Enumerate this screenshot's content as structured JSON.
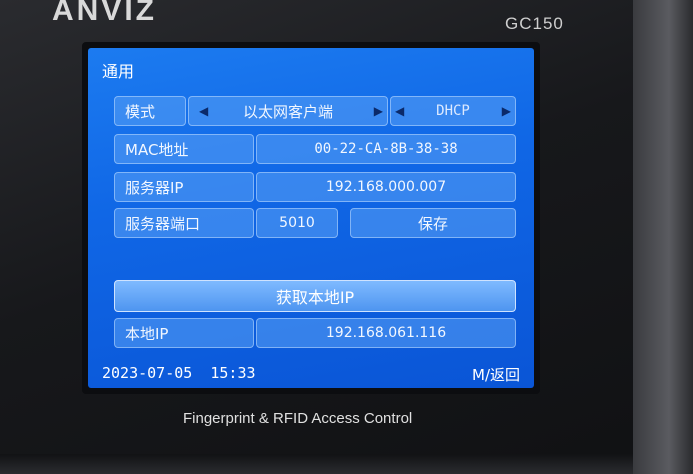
{
  "device": {
    "brand": "ANVIZ",
    "model": "GC150",
    "caption": "Fingerprint & RFID Access Control"
  },
  "screen": {
    "title": "通用",
    "mode": {
      "label": "模式",
      "value": "以太网客户端",
      "ip_mode": "DHCP"
    },
    "mac": {
      "label": "MAC地址",
      "value": "00-22-CA-8B-38-38"
    },
    "server_ip": {
      "label": "服务器IP",
      "value": "192.168.000.007"
    },
    "server_port": {
      "label": "服务器端口",
      "value": "5010",
      "save_label": "保存"
    },
    "get_local_ip_label": "获取本地IP",
    "local_ip": {
      "label": "本地IP",
      "value": "192.168.061.116"
    },
    "status": {
      "datetime": "2023-07-05  15:33",
      "back_hint": "M/返回"
    }
  },
  "colors": {
    "screen_blue": "#1067e6",
    "cell_blue": "#5aa0f5",
    "text": "#ffffff"
  },
  "icons": {
    "left": "triangle-left-icon",
    "right": "triangle-right-icon"
  }
}
